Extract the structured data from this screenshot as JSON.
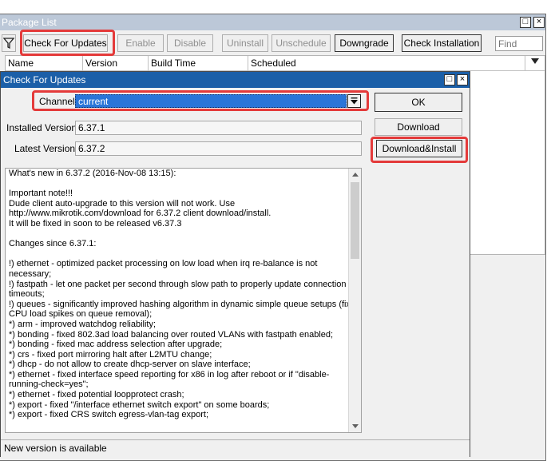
{
  "package_list": {
    "title": "Package List",
    "toolbar": {
      "check_for_updates": "Check For Updates",
      "enable": "Enable",
      "disable": "Disable",
      "uninstall": "Uninstall",
      "unschedule": "Unschedule",
      "downgrade": "Downgrade",
      "check_installation": "Check Installation",
      "find_placeholder": "Find"
    },
    "columns": [
      "Name",
      "Version",
      "Build Time",
      "Scheduled"
    ]
  },
  "check_for_updates": {
    "title": "Check For Updates",
    "channel_label": "Channel:",
    "channel_value": "current",
    "installed_label": "Installed Version:",
    "installed_value": "6.37.1",
    "latest_label": "Latest Version:",
    "latest_value": "6.37.2",
    "buttons": {
      "ok": "OK",
      "download": "Download",
      "download_install": "Download&Install"
    },
    "notes": [
      "What's new in 6.37.2 (2016-Nov-08 13:15):",
      "",
      "Important note!!!",
      "Dude client auto-upgrade to this version will not work. Use",
      "http://www.mikrotik.com/download for 6.37.2 client download/install.",
      "It will be fixed in soon to be released v6.37.3",
      "",
      "Changes since 6.37.1:",
      "",
      "!) ethernet - optimized packet processing on low load when irq re-balance is not",
      "necessary;",
      "!) fastpath - let one packet per second through slow path to properly update connection",
      "timeouts;",
      "!) queues - significantly improved hashing algorithm in dynamic simple queue setups (fixes",
      "CPU load spikes on queue removal);",
      "*) arm - improved watchdog reliability;",
      "*) bonding - fixed 802.3ad load balancing over routed VLANs with fastpath enabled;",
      "*) bonding - fixed mac address selection after upgrade;",
      "*) crs - fixed port mirroring halt after L2MTU change;",
      "*) dhcp - do not allow to create dhcp-server on slave interface;",
      "*) ethernet - fixed interface speed reporting for x86 in log after reboot or if \"disable-",
      "running-check=yes\";",
      "*) ethernet - fixed potential loopprotect crash;",
      "*) export - fixed \"/interface ethernet switch export\" on some boards;",
      "*) export - fixed CRS switch egress-vlan-tag export;"
    ],
    "status": "New version is available"
  }
}
